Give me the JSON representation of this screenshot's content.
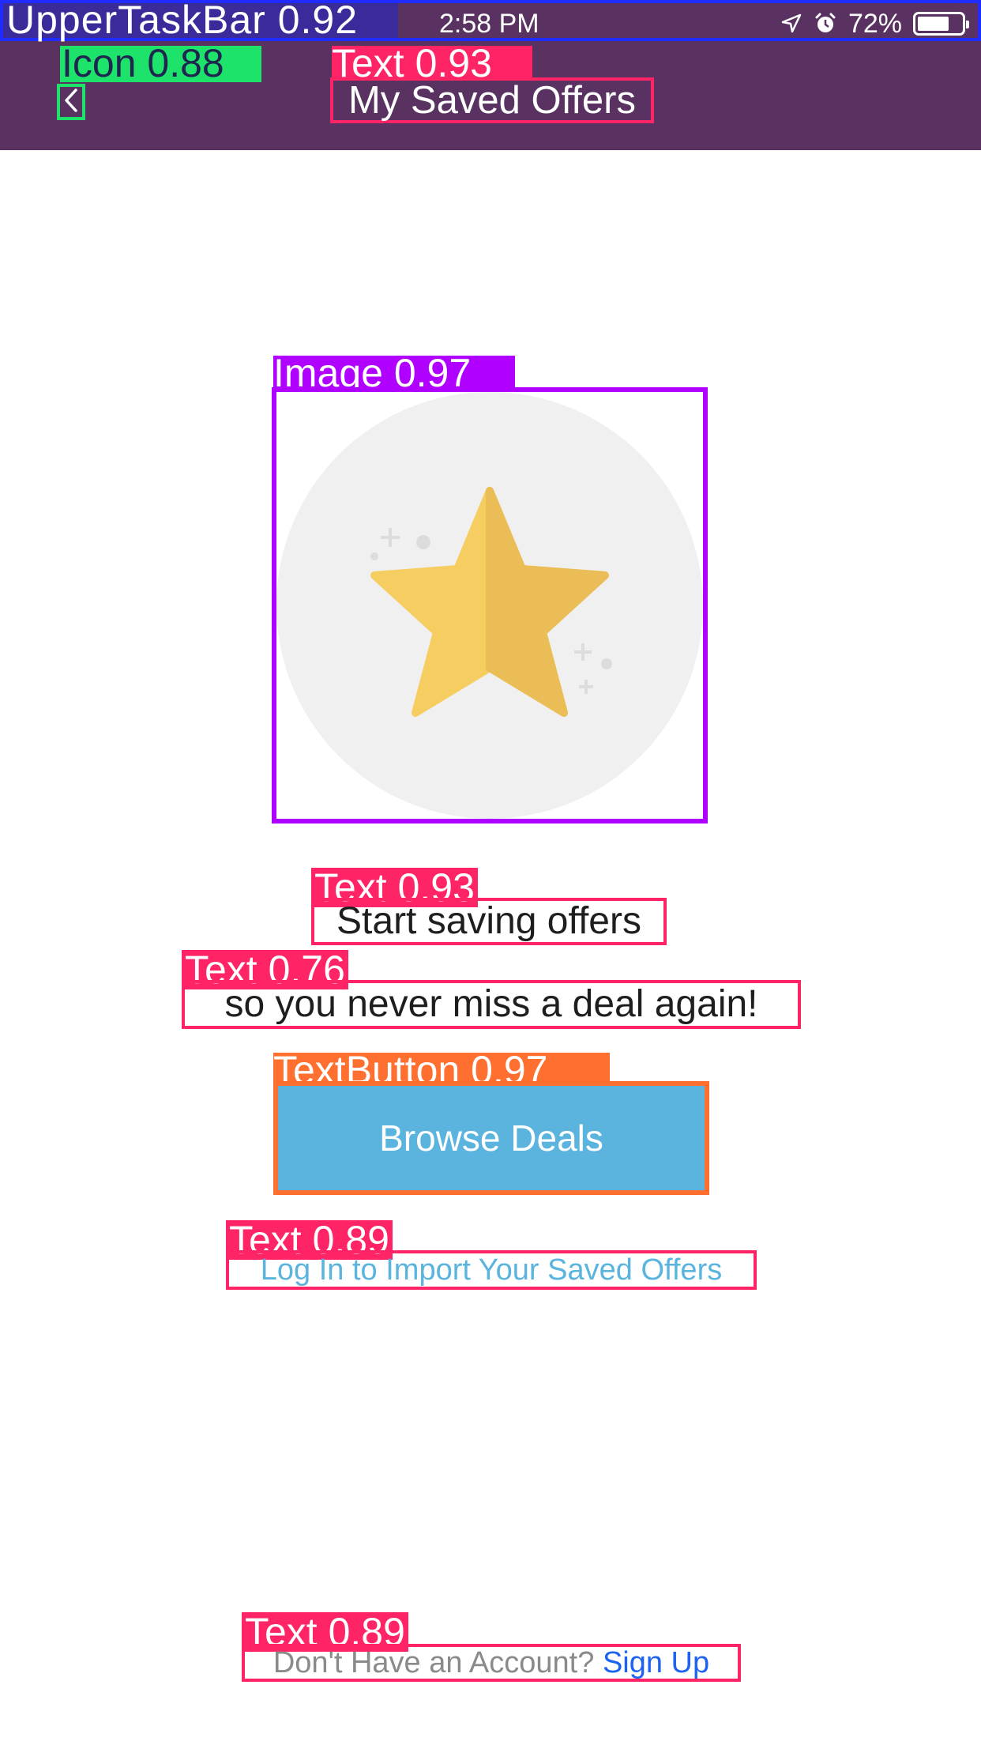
{
  "status_bar": {
    "label": "UpperTaskBar 0.92",
    "time": "2:58 PM",
    "battery": "72%"
  },
  "header": {
    "back_icon_label": "Icon 0.88",
    "title_label": "Text 0.93",
    "title": "My Saved Offers"
  },
  "hero": {
    "label": "Image 0.97"
  },
  "empty_state": {
    "title_label": "Text 0.93",
    "title": "Start saving offers",
    "subtitle_label": "Text 0.76",
    "subtitle": "so you never miss a deal again!"
  },
  "actions": {
    "button_label": "TextButton 0.97",
    "browse_button": "Browse Deals",
    "login_label": "Text 0.89",
    "login_link": "Log In to Import Your Saved Offers"
  },
  "footer": {
    "signup_label": "Text 0.89",
    "prompt": "Don't Have an Account?",
    "signup_link": "Sign Up"
  },
  "colors": {
    "header_bg": "#5a3262",
    "accent_blue": "#5ab4de",
    "link_blue": "#1c63f0",
    "star_yellow": "#f2c55c"
  }
}
